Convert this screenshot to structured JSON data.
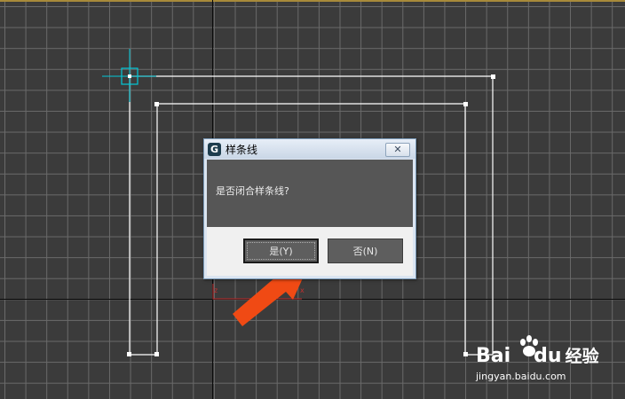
{
  "dialog": {
    "title": "样条线",
    "app_icon": "G",
    "close_glyph": "✕",
    "message": "是否闭合样条线?",
    "yes_label": "是(Y)",
    "no_label": "否(N)"
  },
  "viewport": {
    "axis_label_x": "x",
    "axis_label_z": "z"
  },
  "watermark": {
    "logo_left": "Bai",
    "logo_right": "du",
    "logo_suffix": "经验",
    "url": "jingyan.baidu.com"
  },
  "colors": {
    "viewport_bg": "#3b3b3b",
    "spline": "#ffffff",
    "cursor": "#00c8d8",
    "arrow": "#f04a14",
    "dialog_frame": "#dbe5f1"
  },
  "icons": [
    "app-icon",
    "close-icon",
    "crosshair-cursor-icon",
    "annotation-arrow-icon",
    "baidu-paw-icon"
  ]
}
